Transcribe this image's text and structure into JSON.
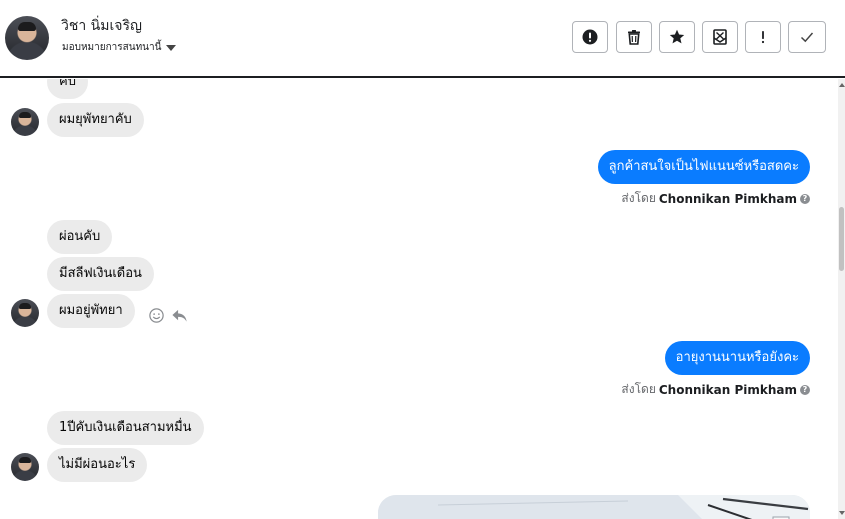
{
  "header": {
    "contact_name": "วิชา นิ่มเจริญ",
    "assign_label": "มอบหมายการสนทนานี้",
    "toolbar": [
      {
        "icon": "alert-circle-icon",
        "title": "alert"
      },
      {
        "icon": "trash-icon",
        "title": "delete"
      },
      {
        "icon": "star-icon",
        "title": "star"
      },
      {
        "icon": "mark-unread-icon",
        "title": "mark unread"
      },
      {
        "icon": "exclamation-icon",
        "title": "spam"
      },
      {
        "icon": "checkmark-icon",
        "title": "done"
      }
    ]
  },
  "messages": {
    "incoming_1": "คับ",
    "incoming_2": "ผมยุพัทยาคับ",
    "outgoing_1": "ลูกค้าสนใจเป็นไฟแนนซ์หรือสดคะ",
    "sent_by_prefix_1": "ส่งโดย",
    "sent_by_name_1": "Chonnikan Pimkham",
    "incoming_3": "ผ่อนคับ",
    "incoming_4": "มีสลีฟเงินเดือน",
    "incoming_5": "ผมอยู่พัทยา",
    "outgoing_2": "อายุงานนานหรือยังคะ",
    "sent_by_prefix_2": "ส่งโดย",
    "sent_by_name_2": "Chonnikan Pimkham",
    "incoming_6": "1ปีคับเงินเดือนสามหมื่น",
    "incoming_7": "ไม่มีผ่อนอะไร",
    "help_glyph": "?"
  },
  "colors": {
    "outgoing_bubble": "#0a7cff",
    "incoming_bubble": "#ebebeb",
    "header_border": "#1c1e21"
  }
}
